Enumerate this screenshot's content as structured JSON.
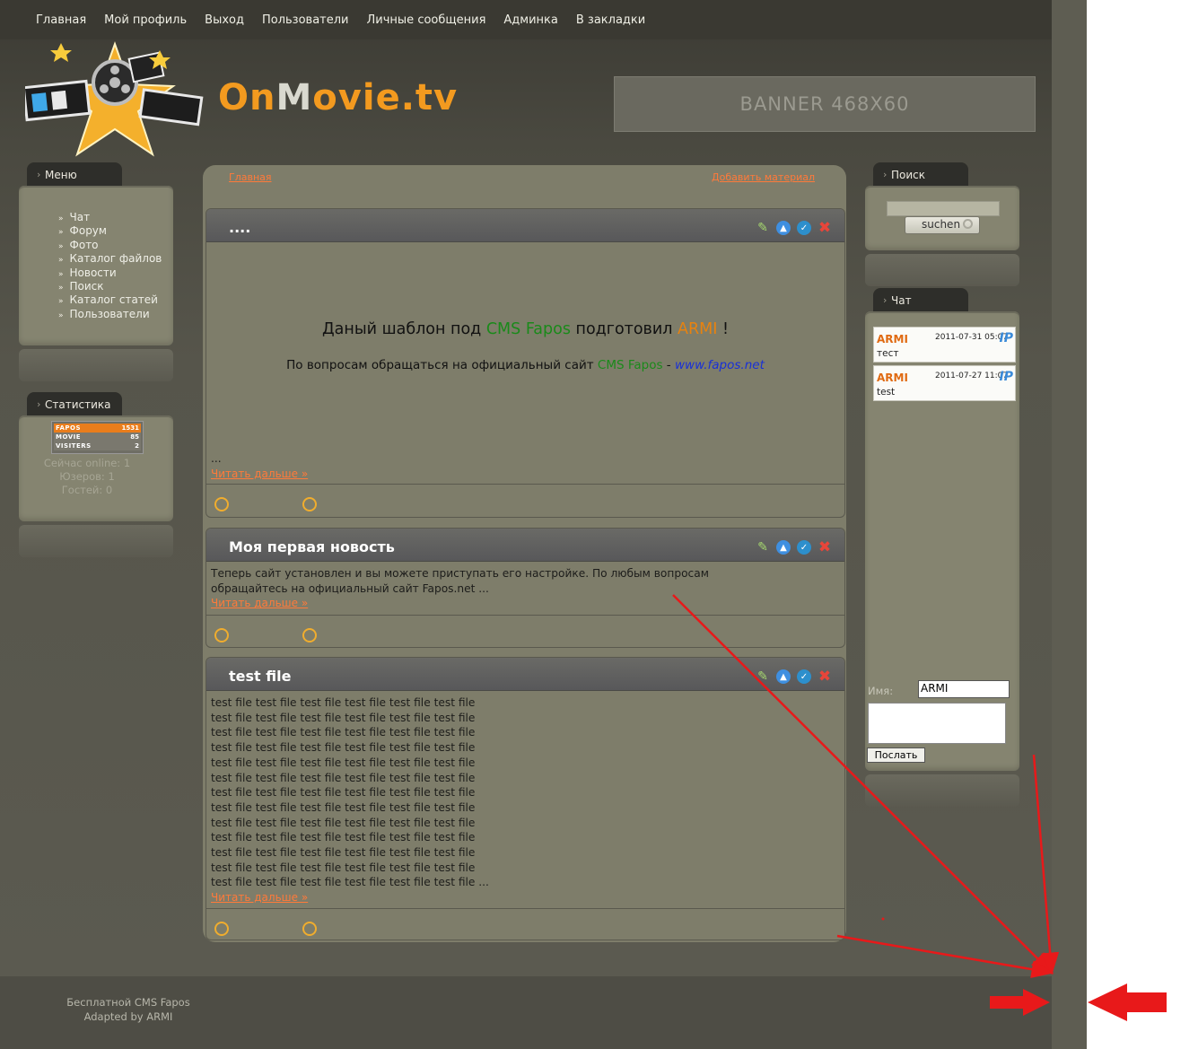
{
  "nav": [
    "Главная",
    "Мой профиль",
    "Выход",
    "Пользователи",
    "Личные сообщения",
    "Админка",
    "В закладки"
  ],
  "logo": {
    "part1": "On",
    "part2": "M",
    "part3": "ovie.tv"
  },
  "banner": "BANNER 468X60",
  "menu": {
    "title": "Меню",
    "items": [
      "Чат",
      "Форум",
      "Фото",
      "Каталог файлов",
      "Новости",
      "Поиск",
      "Каталог статей",
      "Пользователи"
    ]
  },
  "stats": {
    "title": "Статистика",
    "counter": [
      {
        "label": "FAPOS",
        "value": "1531"
      },
      {
        "label": "MOVIE",
        "value": "85"
      },
      {
        "label": "VISITERS",
        "value": "2"
      }
    ],
    "online": "Сейчас online: 1",
    "users": "Юзеров: 1",
    "guests": "Гостей: 0"
  },
  "center": {
    "crumb_home": "Главная",
    "crumb_add": "Добавить материал"
  },
  "posts": [
    {
      "title": "....",
      "line1_a": "Даный шаблон под ",
      "line1_b": "CMS Fapos",
      "line1_c": " подготовил ",
      "line1_d": "ARMI",
      "line1_e": " !",
      "line2_a": "По вопросам обращаться на официальный сайт ",
      "line2_b": "CMS Fapos",
      "line2_c": " - ",
      "line2_d": "www.fapos.net",
      "ellipsis": "...",
      "more": "Читать дальше »"
    },
    {
      "title": "Моя первая новость",
      "body": "Теперь сайт установлен и вы можете приступать его настройке. По любым вопросам обращайтесь на официальный сайт Fapos.net ...",
      "more": "Читать дальше »"
    },
    {
      "title": "test file",
      "lines": [
        "test file test file test file test file test file test file",
        "test file test file test file test file test file test file",
        "test file test file test file test file test file test file",
        "test file test file test file test file test file test file",
        "test file test file test file test file test file test file",
        "test file test file test file test file test file test file",
        "test file test file test file test file test file test file",
        "test file test file test file test file test file test file",
        "test file test file test file test file test file test file",
        "test file test file test file test file test file test file",
        "test file test file test file test file test file test file",
        "test file test file test file test file test file test file",
        "test file test file test file test file test file test file ..."
      ],
      "more": "Читать дальше »"
    }
  ],
  "search": {
    "title": "Поиск",
    "button": "suchen"
  },
  "chat": {
    "title": "Чат",
    "messages": [
      {
        "user": "ARMI",
        "date": "2011-07-31 05:07",
        "ip": "IP",
        "text": "тест"
      },
      {
        "user": "ARMI",
        "date": "2011-07-27 11:07",
        "ip": "IP",
        "text": "test"
      }
    ],
    "name_label": "Имя:",
    "name_value": "ARMI",
    "send": "Послать"
  },
  "footer": {
    "line1": "Бесплатной CMS Fapos",
    "line2": "Adapted by ARMI"
  },
  "colors": {
    "accent_orange": "#ff7a3a",
    "cms_green": "#1a8a1a",
    "annotation_red": "#e8191a"
  }
}
